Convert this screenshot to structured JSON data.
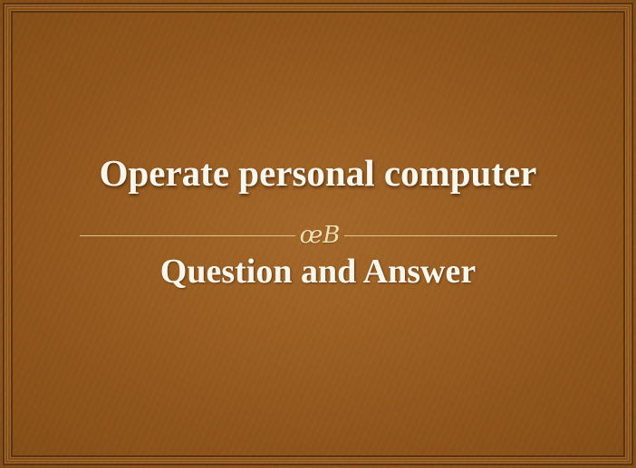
{
  "slide": {
    "title": "Operate personal computer",
    "subtitle": "Question and Answer",
    "ornament": {
      "icon": "flourish-ornament-icon",
      "glyph": "œB"
    }
  },
  "colors": {
    "background": "#8a5119",
    "text": "#fbf6ec",
    "accent": "#e9d7a3",
    "border": "#5b3310"
  }
}
